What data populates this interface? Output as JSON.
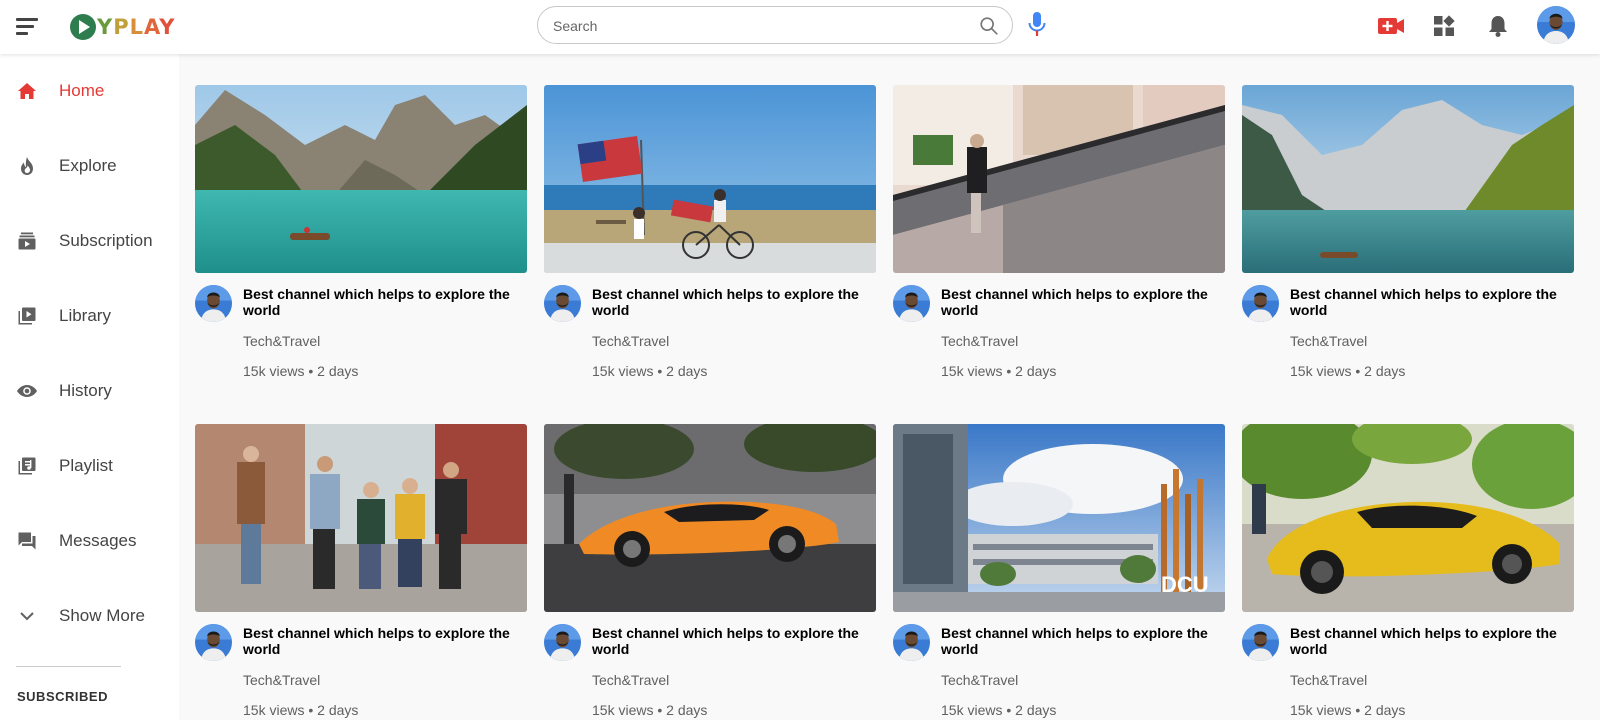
{
  "app": {
    "logo_text": "YPLAY",
    "brand_color": "#e53935"
  },
  "header": {
    "search_placeholder": "Search",
    "icons": [
      "menu-icon",
      "search-icon",
      "mic-icon",
      "video-add-icon",
      "apps-icon",
      "bell-icon",
      "avatar"
    ]
  },
  "sidebar": {
    "items": [
      {
        "label": "Home",
        "icon": "home-icon",
        "active": true
      },
      {
        "label": "Explore",
        "icon": "fire-icon",
        "active": false
      },
      {
        "label": "Subscription",
        "icon": "subscriptions-icon",
        "active": false
      },
      {
        "label": "Library",
        "icon": "library-icon",
        "active": false
      },
      {
        "label": "History",
        "icon": "eye-icon",
        "active": false
      },
      {
        "label": "Playlist",
        "icon": "playlist-icon",
        "active": false
      },
      {
        "label": "Messages",
        "icon": "message-icon",
        "active": false
      },
      {
        "label": "Show More",
        "icon": "chevron-down-icon",
        "active": false
      }
    ],
    "section_heading": "SUBSCRIBED"
  },
  "videos": [
    {
      "title": "Best channel which helps to explore the world",
      "channel": "Tech&Travel",
      "meta": "15k views • 2 days",
      "thumb": "lake-mountains-boat"
    },
    {
      "title": "Best channel which helps to explore the world",
      "channel": "Tech&Travel",
      "meta": "15k views • 2 days",
      "thumb": "beach-flag-bicycle"
    },
    {
      "title": "Best channel which helps to explore the world",
      "channel": "Tech&Travel",
      "meta": "15k views • 2 days",
      "thumb": "mall-escalator"
    },
    {
      "title": "Best channel which helps to explore the world",
      "channel": "Tech&Travel",
      "meta": "15k views • 2 days",
      "thumb": "alpine-lake-boat"
    },
    {
      "title": "Best channel which helps to explore the world",
      "channel": "Tech&Travel",
      "meta": "15k views • 2 days",
      "thumb": "friends-walking"
    },
    {
      "title": "Best channel which helps to explore the world",
      "channel": "Tech&Travel",
      "meta": "15k views • 2 days",
      "thumb": "orange-sports-car"
    },
    {
      "title": "Best channel which helps to explore the world",
      "channel": "Tech&Travel",
      "meta": "15k views • 2 days",
      "thumb": "campus-building-dcu"
    },
    {
      "title": "Best channel which helps to explore the world",
      "channel": "Tech&Travel",
      "meta": "15k views • 2 days",
      "thumb": "yellow-sports-car"
    }
  ],
  "thumb_labels": {
    "campus": "DCU"
  }
}
